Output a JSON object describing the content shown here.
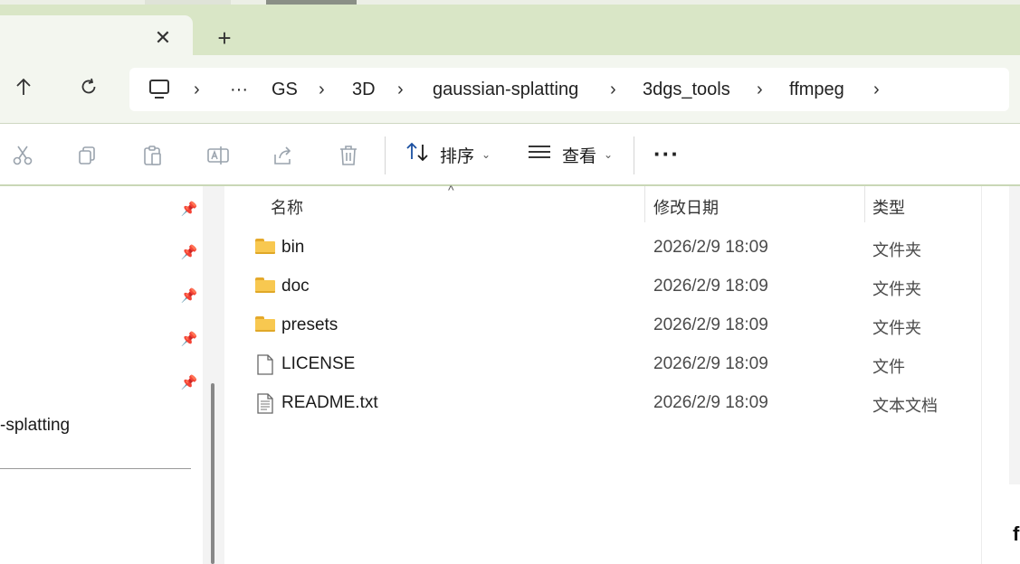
{
  "tab": {
    "close_glyph": "✕",
    "new_tab_glyph": "+"
  },
  "nav": {
    "up_icon": "up-arrow-icon",
    "refresh_icon": "refresh-icon"
  },
  "breadcrumb": {
    "overflow": "···",
    "items": [
      "GS",
      "3D",
      "gaussian-splatting",
      "3dgs_tools",
      "ffmpeg"
    ]
  },
  "toolbar": {
    "sort_label": "排序",
    "view_label": "查看",
    "more_label": "···"
  },
  "navpane": {
    "pinned_count": 5,
    "visible_item": "-splatting"
  },
  "columns": {
    "name": "名称",
    "date": "修改日期",
    "type": "类型"
  },
  "files": [
    {
      "name": "bin",
      "date": "2026/2/9 18:09",
      "type": "文件夹",
      "kind": "folder"
    },
    {
      "name": "doc",
      "date": "2026/2/9 18:09",
      "type": "文件夹",
      "kind": "folder"
    },
    {
      "name": "presets",
      "date": "2026/2/9 18:09",
      "type": "文件夹",
      "kind": "folder"
    },
    {
      "name": "LICENSE",
      "date": "2026/2/9 18:09",
      "type": "文件",
      "kind": "file"
    },
    {
      "name": "README.txt",
      "date": "2026/2/9 18:09",
      "type": "文本文档",
      "kind": "text"
    }
  ],
  "rightpane": {
    "fragment": "f"
  },
  "colors": {
    "tabbar": "#d9e6c6",
    "accent": "#1a4fa0",
    "folder": "#f8c850"
  }
}
